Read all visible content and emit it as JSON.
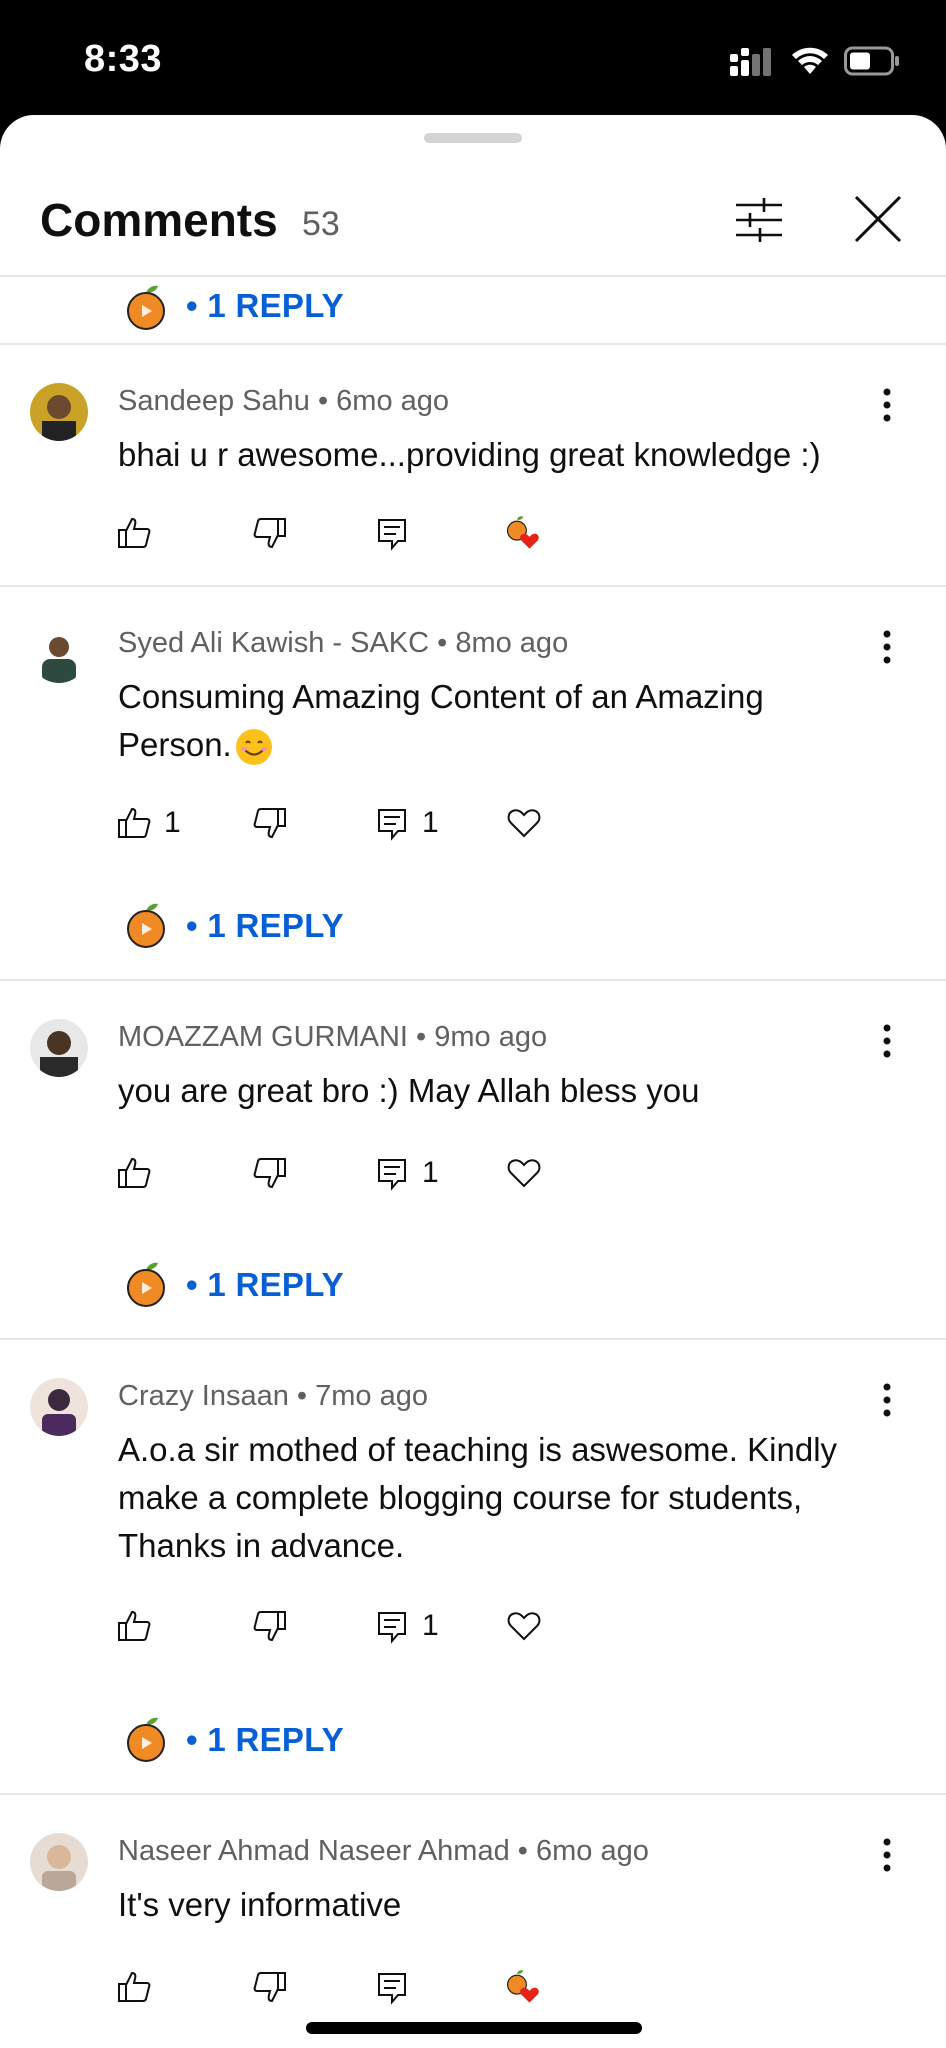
{
  "status_bar": {
    "time": "8:33"
  },
  "header": {
    "title": "Comments",
    "count": "53"
  },
  "reply_label": "• 1 REPLY",
  "comments": [
    {
      "author": "Sandeep Sahu",
      "age": "6mo ago",
      "meta": "Sandeep Sahu • 6mo ago",
      "text": "bhai u r awesome...providing great knowledge :)",
      "likes": "",
      "replies": "",
      "creator_hearted": true
    },
    {
      "author": "Syed Ali Kawish - SAKC",
      "age": "8mo ago",
      "meta": "Syed Ali Kawish - SAKC • 8mo ago",
      "text_line1": "Consuming Amazing Content of an Amazing",
      "text_line2": "Person.",
      "likes": "1",
      "replies": "1",
      "creator_hearted": false
    },
    {
      "author": "MOAZZAM GURMANI",
      "age": "9mo ago",
      "meta": "MOAZZAM GURMANI • 9mo ago",
      "text": "you are great bro :) May Allah bless you",
      "likes": "",
      "replies": "1",
      "creator_hearted": false
    },
    {
      "author": "Crazy Insaan",
      "age": "7mo ago",
      "meta": "Crazy Insaan • 7mo ago",
      "text": "A.o.a sir mothed of teaching is aswesome. Kindly make a complete blogging course for students, Thanks in advance.",
      "likes": "",
      "replies": "1",
      "creator_hearted": false
    },
    {
      "author": "Naseer Ahmad Naseer Ahmad",
      "age": "6mo ago",
      "meta": "Naseer Ahmad Naseer Ahmad • 6mo ago",
      "text": "It's very informative",
      "likes": "",
      "replies": "",
      "creator_hearted": true
    }
  ],
  "colors": {
    "link_blue": "#065fd4",
    "secondary_text": "#606060",
    "divider": "#e5e5e5",
    "heart_red": "#e62117",
    "orange_avatar": "#f08a24"
  }
}
